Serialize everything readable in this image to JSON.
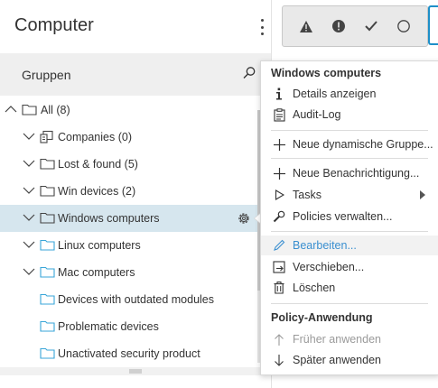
{
  "left_panel": {
    "title": "Computer",
    "groups_label": "Gruppen",
    "tree": [
      {
        "label": "All (8)",
        "icon": "folder"
      },
      {
        "label": "Companies (0)",
        "icon": "companies"
      },
      {
        "label": "Lost & found (5)",
        "icon": "folder"
      },
      {
        "label": "Win devices (2)",
        "icon": "folder"
      },
      {
        "label": "Windows computers",
        "icon": "folder",
        "selected": true
      },
      {
        "label": "Linux computers",
        "icon": "folder-blue"
      },
      {
        "label": "Mac computers",
        "icon": "folder-blue"
      },
      {
        "label": "Devices with outdated modules",
        "icon": "folder-blue"
      },
      {
        "label": "Problematic devices",
        "icon": "folder-blue"
      },
      {
        "label": "Unactivated security product",
        "icon": "folder-blue"
      }
    ]
  },
  "toolbar": {
    "filters": [
      "warning-icon",
      "exclamation-icon",
      "check-icon",
      "circle-icon"
    ],
    "accent": "#1e8fc8"
  },
  "context_menu": {
    "header": "Windows computers",
    "items": [
      {
        "label": "Details anzeigen",
        "icon": "info-icon"
      },
      {
        "label": "Audit-Log",
        "icon": "clipboard-icon"
      },
      {
        "label": "Neue dynamische Gruppe...",
        "icon": "plus-icon"
      },
      {
        "label": "Neue Benachrichtigung...",
        "icon": "plus-icon"
      },
      {
        "label": "Tasks",
        "icon": "play-icon"
      },
      {
        "label": "Policies verwalten...",
        "icon": "wrench-icon"
      },
      {
        "label": "Bearbeiten...",
        "icon": "pencil-icon"
      },
      {
        "label": "Verschieben...",
        "icon": "move-icon"
      },
      {
        "label": "Löschen",
        "icon": "trash-icon"
      }
    ],
    "policy_header": "Policy-Anwendung",
    "policy_items": [
      {
        "label": "Früher anwenden",
        "icon": "arrow-up-icon"
      },
      {
        "label": "Später anwenden",
        "icon": "arrow-down-icon"
      }
    ],
    "highlight_color": "#3a8fd0"
  }
}
